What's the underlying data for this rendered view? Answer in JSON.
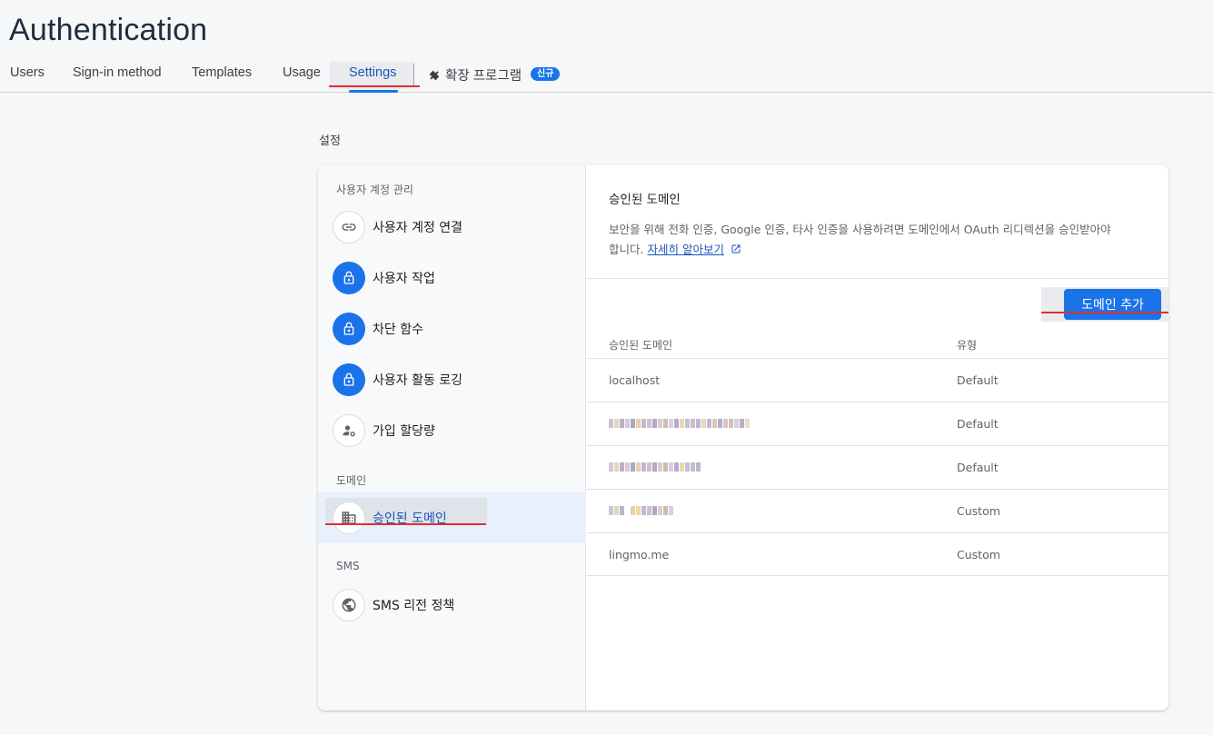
{
  "page": {
    "title": "Authentication"
  },
  "tabs": [
    {
      "label": "Users"
    },
    {
      "label": "Sign-in method"
    },
    {
      "label": "Templates"
    },
    {
      "label": "Usage"
    },
    {
      "label": "Settings",
      "active": true
    },
    {
      "label": "확장 프로그램",
      "badge": "신규",
      "icon": "extension-icon"
    }
  ],
  "section_label": "설정",
  "nav": {
    "groups": [
      {
        "label": "사용자 계정 관리",
        "items": [
          {
            "label": "사용자 계정 연결",
            "icon": "link-icon"
          },
          {
            "label": "사용자 작업",
            "icon": "lock-icon"
          },
          {
            "label": "차단 함수",
            "icon": "lock-icon"
          },
          {
            "label": "사용자 활동 로깅",
            "icon": "lock-icon"
          },
          {
            "label": "가입 할당량",
            "icon": "user-settings-icon"
          }
        ]
      },
      {
        "label": "도메인",
        "items": [
          {
            "label": "승인된 도메인",
            "icon": "building-icon",
            "selected": true
          }
        ]
      },
      {
        "label": "SMS",
        "items": [
          {
            "label": "SMS 리전 정책",
            "icon": "globe-icon"
          }
        ]
      }
    ]
  },
  "domains_panel": {
    "title": "승인된 도메인",
    "description_line1": "보안을 위해 전화 인증, Google 인증, 타사 인증을 사용하려면 도메인에서 OAuth 리디렉션을 승인받아야",
    "description_line2": "합니다.",
    "learn_more": "자세히 알아보기",
    "add_button": "도메인 추가",
    "columns": {
      "domain": "승인된 도메인",
      "type": "유형"
    },
    "rows": [
      {
        "domain": "localhost",
        "type": "Default"
      },
      {
        "domain": "",
        "type": "Default"
      },
      {
        "domain": "",
        "type": "Default"
      },
      {
        "domain": "",
        "type": "Custom"
      },
      {
        "domain": "lingmo.me",
        "type": "Custom"
      }
    ]
  },
  "colors": {
    "accent": "#1a73e8",
    "annotation_red": "#e03030"
  }
}
